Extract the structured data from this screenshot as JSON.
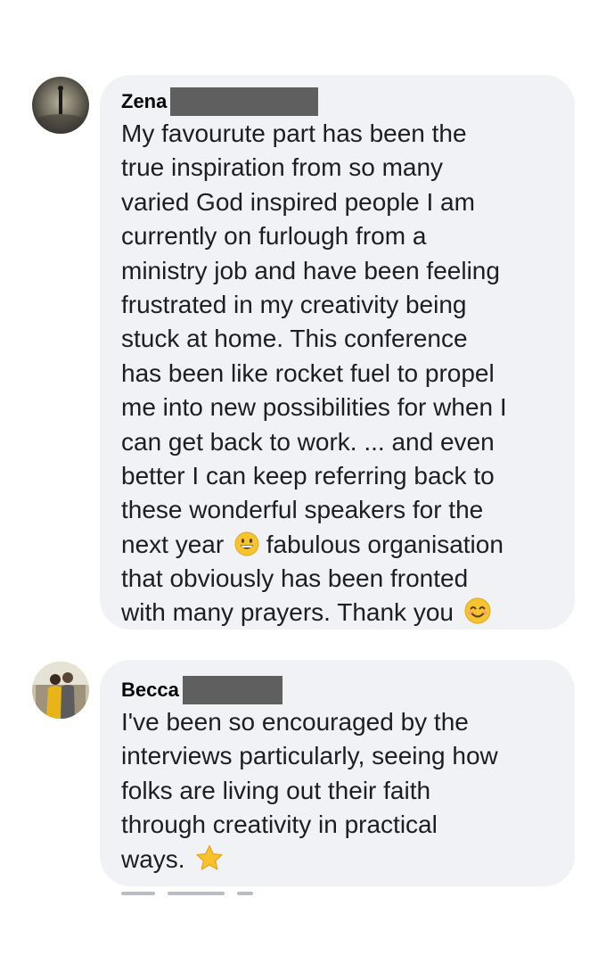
{
  "comments": [
    {
      "author": "Zena",
      "lines": [
        "My favourute part has been the",
        "true inspiration from so many",
        "varied God inspired people I am",
        "currently on furlough from a",
        "ministry job and have been feeling",
        "frustrated in my creativity being",
        "stuck at home. This conference",
        "has been like rocket fuel to propel",
        "me into new possibilities for when I",
        "can get back to work. ... and even",
        "better I can keep referring back to",
        "these wonderful speakers for the",
        "next year",
        "fabulous organisation",
        "that obviously has been fronted",
        "with many prayers. Thank you"
      ],
      "emojis": [
        "grinning-face-emoji",
        "smiling-face-with-smiling-eyes-emoji"
      ]
    },
    {
      "author": "Becca",
      "lines": [
        "I've been so encouraged by the",
        "interviews particularly, seeing how",
        "folks are living out their faith",
        "through creativity in practical",
        "ways."
      ],
      "emojis": [
        "star-emoji"
      ]
    }
  ],
  "colors": {
    "bubble": "#f0f2f5",
    "text": "#1c1e21",
    "redaction": "#5f5f5f"
  }
}
